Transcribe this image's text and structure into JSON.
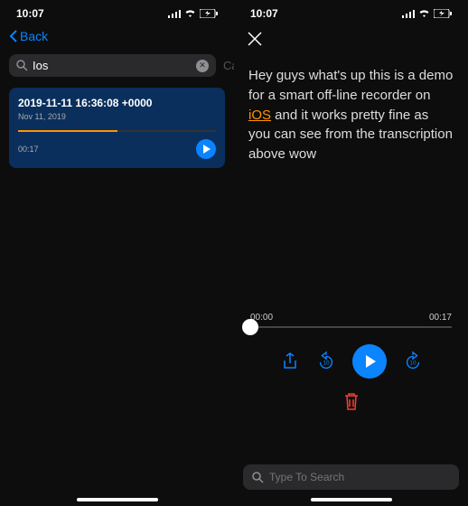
{
  "status": {
    "time": "10:07"
  },
  "screen1": {
    "back_label": "Back",
    "search_value": "Ios",
    "cancel_label": "Cancel",
    "recording": {
      "title": "2019-11-11 16:36:08 +0000",
      "date": "Nov 11, 2019",
      "duration": "00:17"
    }
  },
  "screen2": {
    "transcript_before": "Hey guys what's up this is a demo for a smart off-line recorder on ",
    "transcript_highlight": "iOS",
    "transcript_after": " and it works pretty fine as you can see from the transcription above wow",
    "time_current": "00:00",
    "time_total": "00:17",
    "search_placeholder": "Type To Search"
  }
}
